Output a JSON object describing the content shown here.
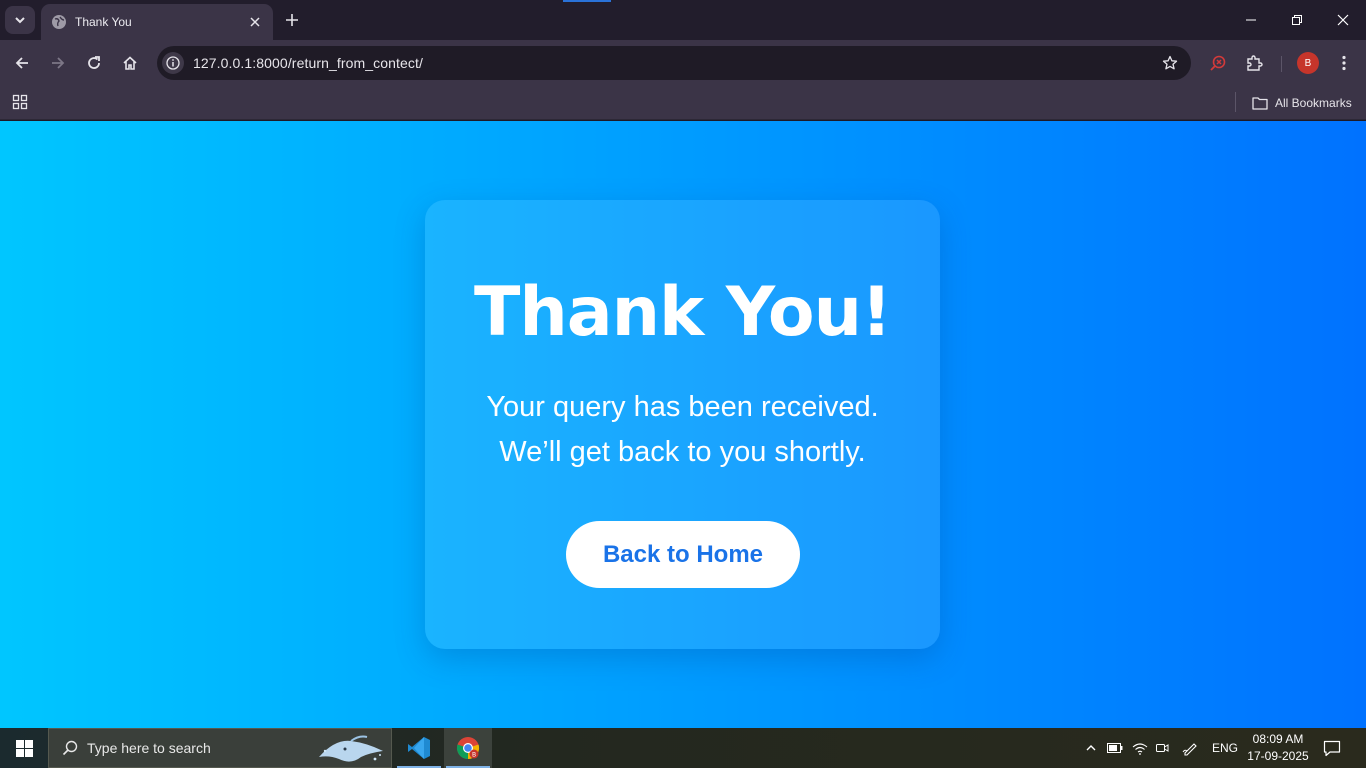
{
  "browser": {
    "tab": {
      "title": "Thank You"
    },
    "address_bar": {
      "url": "127.0.0.1:8000/return_from_contect/"
    },
    "profile": {
      "initial": "B"
    },
    "bookmarks_bar": {
      "all_bookmarks_label": "All Bookmarks"
    }
  },
  "page": {
    "heading": "Thank You!",
    "message_line1": "Your query has been received.",
    "message_line2": "We’ll get back to you shortly.",
    "back_button_label": "Back to Home",
    "gradient": {
      "start": "#00c6ff",
      "end": "#0072ff"
    },
    "button_text_color": "#1a73e8"
  },
  "taskbar": {
    "search_placeholder": "Type here to search",
    "pinned_apps": [
      "vscode-icon",
      "chrome-icon"
    ],
    "language": "ENG",
    "time": "08:09 AM",
    "date": "17-09-2025"
  }
}
